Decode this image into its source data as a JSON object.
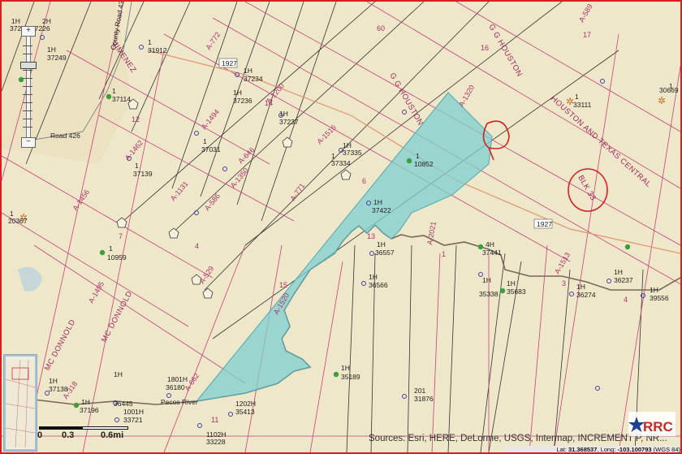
{
  "map": {
    "attribution": "Sources: Esri, HERE, DeLorme, USGS, Intermap, INCREMENT P, NR...",
    "latitude": "31.368537",
    "longitude": "-103.100793",
    "datum": "(WGS 84)",
    "lat_label": "Lat:",
    "long_label": "Long:",
    "scale": {
      "labels": [
        "0",
        "0.3",
        "0.6mi"
      ]
    },
    "logo_text": "RRC",
    "colors": {
      "background": "#efe7c9",
      "survey_lines": "#c8407a",
      "lease_polygon": "#7fcfd0",
      "annotation": "#d42020",
      "river": "#7a6658"
    },
    "roads": {
      "county_road_432": "County Road 432",
      "road_426": "Road 426",
      "highway_1927": "1927"
    },
    "river_label": "Pecos River",
    "survey_labels": [
      "G G HOUSTON",
      "HOUSTON AND TEXAS CENTRAL",
      "MC DONNOLD",
      "JIMENEZ",
      "BLK 33"
    ],
    "abstracts": [
      "A-772",
      "A-1200",
      "A-1494",
      "A-1516",
      "A-1462",
      "A-646",
      "A-1350",
      "A-1131",
      "A-586",
      "A-771",
      "A-1456",
      "A-1495",
      "A-529",
      "A-318",
      "A-662",
      "A-1320",
      "A-1513",
      "A-2021",
      "A-1520",
      "A-589"
    ],
    "section_numbers": [
      "60",
      "16",
      "17",
      "6",
      "13",
      "14",
      "15",
      "12",
      "7",
      "4",
      "3",
      "11",
      "1",
      "2"
    ],
    "wells": [
      {
        "name": "1H",
        "api": "37236"
      },
      {
        "name": "2H",
        "api": "37226"
      },
      {
        "name": "1H",
        "api": "37249"
      },
      {
        "name": "1",
        "api": "31912"
      },
      {
        "name": "1H",
        "api": "37234"
      },
      {
        "name": "1H",
        "api": "37236"
      },
      {
        "name": "1H",
        "api": "37237"
      },
      {
        "name": "1",
        "api": "37031"
      },
      {
        "name": "1",
        "api": "37139"
      },
      {
        "name": "1H",
        "api": "37335"
      },
      {
        "name": "1",
        "api": "37334"
      },
      {
        "name": "1",
        "api": "10852"
      },
      {
        "name": "1H",
        "api": "37422"
      },
      {
        "name": "1",
        "api": "20367"
      },
      {
        "name": "1",
        "api": "10959"
      },
      {
        "name": "1H",
        "api": "36557"
      },
      {
        "name": "1H",
        "api": "36566"
      },
      {
        "name": "1",
        "api": "33111"
      },
      {
        "name": "1",
        "api": "30669"
      },
      {
        "name": "4H",
        "api": "37441"
      },
      {
        "name": "1H",
        "api": "35338"
      },
      {
        "name": "1H",
        "api": "35683"
      },
      {
        "name": "1H",
        "api": "36237"
      },
      {
        "name": "1H",
        "api": "36274"
      },
      {
        "name": "1H",
        "api": "39556"
      },
      {
        "name": "1H",
        "api": "37138"
      },
      {
        "name": "1H",
        "api": "36445"
      },
      {
        "name": "1H",
        "api": "37196"
      },
      {
        "name": "1801H",
        "api": "36180"
      },
      {
        "name": "1001H",
        "api": "33721"
      },
      {
        "name": "1H",
        "api": "35189"
      },
      {
        "name": "201",
        "api": "31876"
      },
      {
        "name": "1202H",
        "api": "35413"
      },
      {
        "name": "1102H",
        "api": "33228"
      },
      {
        "name": "1",
        "api": "37114"
      }
    ],
    "zoom": {
      "in_label": "+",
      "out_label": "−"
    }
  }
}
